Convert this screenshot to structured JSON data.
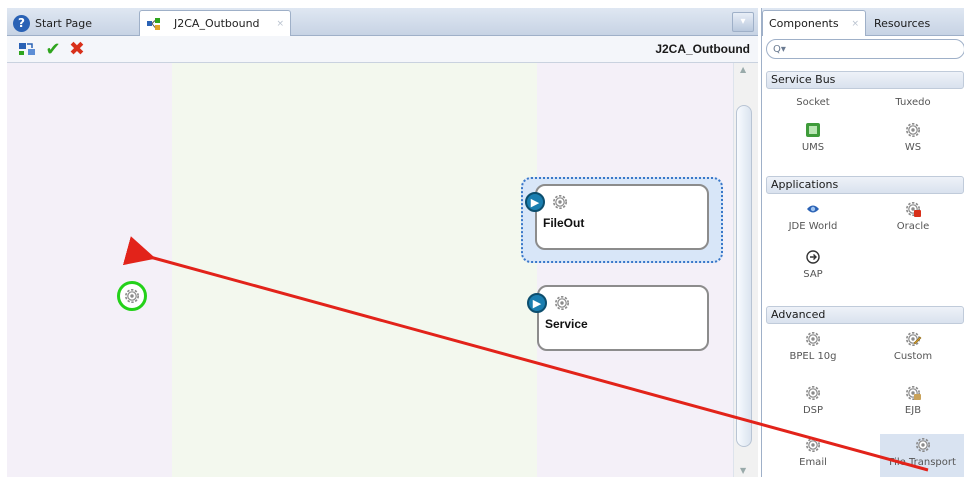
{
  "editor": {
    "tabs": [
      {
        "label": "Start Page",
        "close": "×"
      },
      {
        "label": "J2CA_Outbound",
        "close": "×"
      }
    ],
    "toolbar": {
      "check": "✔",
      "cross": "✖"
    },
    "composite_title": "J2CA_Outbound",
    "cards": {
      "fileout": {
        "label": "FileOut"
      },
      "service": {
        "label": "Service"
      }
    }
  },
  "palette": {
    "tabs": [
      {
        "label": "Components",
        "close": "×"
      },
      {
        "label": "Resources"
      }
    ],
    "search": {
      "prefix": "Q▾",
      "placeholder": ""
    },
    "groups": [
      {
        "label": "Service Bus"
      },
      {
        "label": "Applications"
      },
      {
        "label": "Advanced"
      }
    ],
    "items": {
      "socket": "Socket",
      "tuxedo": "Tuxedo",
      "ums": "UMS",
      "ws": "WS",
      "jde_world": "JDE World",
      "oracle": "Oracle",
      "sap": "SAP",
      "bpel": "BPEL 10g",
      "custom": "Custom",
      "dsp": "DSP",
      "ejb": "EJB",
      "email": "Email",
      "file_transport": "File Transport"
    }
  },
  "colors": {
    "drag_arrow": "#e2231a",
    "drop_ring": "#24d11a",
    "service_badge": "#1a7eb0"
  }
}
